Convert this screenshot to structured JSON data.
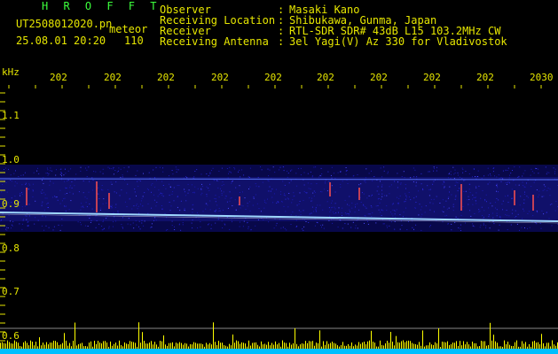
{
  "header": {
    "title": "H R O F F T",
    "filename": "UT2508012020.pn",
    "type": "meteor",
    "datetime": "25.08.01 20:20",
    "count": "110"
  },
  "info": [
    {
      "label": "Observer",
      "value": "Masaki Kano"
    },
    {
      "label": "Receiving Location",
      "value": "Shibukawa, Gunma, Japan"
    },
    {
      "label": "Receiver",
      "value": "RTL-SDR SDR# 43dB L15 103.2MHz CW"
    },
    {
      "label": "Receiving Antenna",
      "value": "3el Yagi(V) Az 330 for Vladivostok"
    }
  ],
  "axis": {
    "y_unit": "kHz",
    "y_ticks": [
      "1.1",
      "1.0",
      "0.9",
      "0.8",
      "0.7",
      "0.6"
    ],
    "x_ticks": [
      "202",
      "202",
      "202",
      "202",
      "202",
      "202",
      "202",
      "202",
      "202",
      "2030"
    ]
  },
  "colors": {
    "background": "#000000",
    "text": "#e6e600",
    "title": "#3cff3c",
    "tick_mark": "#e6e600",
    "noise": "#1a1ab0",
    "carrier": "#9fd8ff",
    "meteor": "#ff5050",
    "count_bars": "#ffff00",
    "baseline": "#00bfff"
  }
}
